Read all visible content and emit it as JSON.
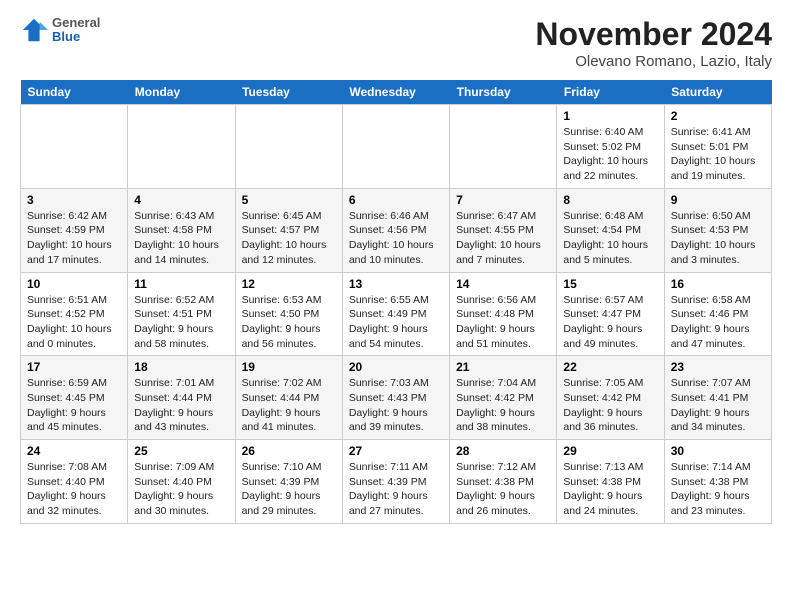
{
  "logo": {
    "general": "General",
    "blue": "Blue"
  },
  "title": "November 2024",
  "location": "Olevano Romano, Lazio, Italy",
  "days_header": [
    "Sunday",
    "Monday",
    "Tuesday",
    "Wednesday",
    "Thursday",
    "Friday",
    "Saturday"
  ],
  "weeks": [
    [
      {
        "day": "",
        "info": ""
      },
      {
        "day": "",
        "info": ""
      },
      {
        "day": "",
        "info": ""
      },
      {
        "day": "",
        "info": ""
      },
      {
        "day": "",
        "info": ""
      },
      {
        "day": "1",
        "info": "Sunrise: 6:40 AM\nSunset: 5:02 PM\nDaylight: 10 hours\nand 22 minutes."
      },
      {
        "day": "2",
        "info": "Sunrise: 6:41 AM\nSunset: 5:01 PM\nDaylight: 10 hours\nand 19 minutes."
      }
    ],
    [
      {
        "day": "3",
        "info": "Sunrise: 6:42 AM\nSunset: 4:59 PM\nDaylight: 10 hours\nand 17 minutes."
      },
      {
        "day": "4",
        "info": "Sunrise: 6:43 AM\nSunset: 4:58 PM\nDaylight: 10 hours\nand 14 minutes."
      },
      {
        "day": "5",
        "info": "Sunrise: 6:45 AM\nSunset: 4:57 PM\nDaylight: 10 hours\nand 12 minutes."
      },
      {
        "day": "6",
        "info": "Sunrise: 6:46 AM\nSunset: 4:56 PM\nDaylight: 10 hours\nand 10 minutes."
      },
      {
        "day": "7",
        "info": "Sunrise: 6:47 AM\nSunset: 4:55 PM\nDaylight: 10 hours\nand 7 minutes."
      },
      {
        "day": "8",
        "info": "Sunrise: 6:48 AM\nSunset: 4:54 PM\nDaylight: 10 hours\nand 5 minutes."
      },
      {
        "day": "9",
        "info": "Sunrise: 6:50 AM\nSunset: 4:53 PM\nDaylight: 10 hours\nand 3 minutes."
      }
    ],
    [
      {
        "day": "10",
        "info": "Sunrise: 6:51 AM\nSunset: 4:52 PM\nDaylight: 10 hours\nand 0 minutes."
      },
      {
        "day": "11",
        "info": "Sunrise: 6:52 AM\nSunset: 4:51 PM\nDaylight: 9 hours\nand 58 minutes."
      },
      {
        "day": "12",
        "info": "Sunrise: 6:53 AM\nSunset: 4:50 PM\nDaylight: 9 hours\nand 56 minutes."
      },
      {
        "day": "13",
        "info": "Sunrise: 6:55 AM\nSunset: 4:49 PM\nDaylight: 9 hours\nand 54 minutes."
      },
      {
        "day": "14",
        "info": "Sunrise: 6:56 AM\nSunset: 4:48 PM\nDaylight: 9 hours\nand 51 minutes."
      },
      {
        "day": "15",
        "info": "Sunrise: 6:57 AM\nSunset: 4:47 PM\nDaylight: 9 hours\nand 49 minutes."
      },
      {
        "day": "16",
        "info": "Sunrise: 6:58 AM\nSunset: 4:46 PM\nDaylight: 9 hours\nand 47 minutes."
      }
    ],
    [
      {
        "day": "17",
        "info": "Sunrise: 6:59 AM\nSunset: 4:45 PM\nDaylight: 9 hours\nand 45 minutes."
      },
      {
        "day": "18",
        "info": "Sunrise: 7:01 AM\nSunset: 4:44 PM\nDaylight: 9 hours\nand 43 minutes."
      },
      {
        "day": "19",
        "info": "Sunrise: 7:02 AM\nSunset: 4:44 PM\nDaylight: 9 hours\nand 41 minutes."
      },
      {
        "day": "20",
        "info": "Sunrise: 7:03 AM\nSunset: 4:43 PM\nDaylight: 9 hours\nand 39 minutes."
      },
      {
        "day": "21",
        "info": "Sunrise: 7:04 AM\nSunset: 4:42 PM\nDaylight: 9 hours\nand 38 minutes."
      },
      {
        "day": "22",
        "info": "Sunrise: 7:05 AM\nSunset: 4:42 PM\nDaylight: 9 hours\nand 36 minutes."
      },
      {
        "day": "23",
        "info": "Sunrise: 7:07 AM\nSunset: 4:41 PM\nDaylight: 9 hours\nand 34 minutes."
      }
    ],
    [
      {
        "day": "24",
        "info": "Sunrise: 7:08 AM\nSunset: 4:40 PM\nDaylight: 9 hours\nand 32 minutes."
      },
      {
        "day": "25",
        "info": "Sunrise: 7:09 AM\nSunset: 4:40 PM\nDaylight: 9 hours\nand 30 minutes."
      },
      {
        "day": "26",
        "info": "Sunrise: 7:10 AM\nSunset: 4:39 PM\nDaylight: 9 hours\nand 29 minutes."
      },
      {
        "day": "27",
        "info": "Sunrise: 7:11 AM\nSunset: 4:39 PM\nDaylight: 9 hours\nand 27 minutes."
      },
      {
        "day": "28",
        "info": "Sunrise: 7:12 AM\nSunset: 4:38 PM\nDaylight: 9 hours\nand 26 minutes."
      },
      {
        "day": "29",
        "info": "Sunrise: 7:13 AM\nSunset: 4:38 PM\nDaylight: 9 hours\nand 24 minutes."
      },
      {
        "day": "30",
        "info": "Sunrise: 7:14 AM\nSunset: 4:38 PM\nDaylight: 9 hours\nand 23 minutes."
      }
    ]
  ]
}
